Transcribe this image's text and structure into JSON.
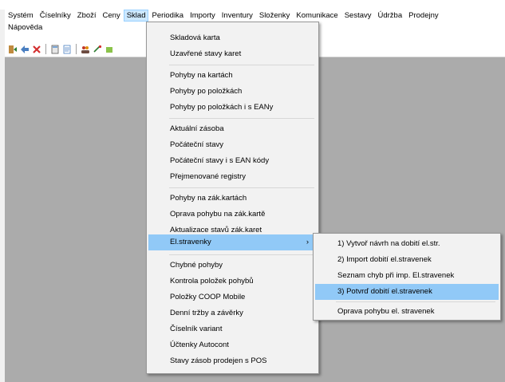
{
  "menubar": {
    "row1": [
      "Systém",
      "Číselníky",
      "Zboží",
      "Ceny",
      "Sklad",
      "Periodika",
      "Importy",
      "Inventury",
      "Složenky",
      "Komunikace",
      "Sestavy",
      "Údržba",
      "Prodejny"
    ],
    "row2": [
      "Nápověda"
    ],
    "active": "Sklad"
  },
  "toolbar": {
    "icons": [
      "door-exit-icon",
      "back-arrow-icon",
      "close-x-icon",
      "calculator-icon",
      "document-icon",
      "users-icon",
      "refresh-icon",
      "package-icon"
    ]
  },
  "sklad_menu": {
    "items": [
      {
        "label": "Skladová karta"
      },
      {
        "label": "Uzavřené stavy karet"
      },
      {
        "label": "Pohyby na kartách"
      },
      {
        "label": "Pohyby po položkách"
      },
      {
        "label": "Pohyby po položkách i s EANy"
      },
      {
        "label": "Aktuální zásoba"
      },
      {
        "label": "Počáteční stavy"
      },
      {
        "label": "Počáteční stavy i s EAN kódy"
      },
      {
        "label": "Přejmenované registry"
      },
      {
        "label": "Pohyby na zák.kartách"
      },
      {
        "label": "Oprava pohybu na zák.kartě"
      },
      {
        "label": "Aktualizace stavů zák.karet"
      },
      {
        "label": "El.stravenky",
        "submenu_arrow": "›"
      },
      {
        "label": "Chybné pohyby"
      },
      {
        "label": "Kontrola položek pohybů"
      },
      {
        "label": "Položky COOP Mobile"
      },
      {
        "label": "Denní tržby a závěrky"
      },
      {
        "label": "Číselník variant"
      },
      {
        "label": "Účtenky Autocont"
      },
      {
        "label": "Stavy zásob prodejen s POS"
      }
    ]
  },
  "elstravenky_menu": {
    "items": [
      {
        "label": "1) Vytvoř návrh na dobití el.str."
      },
      {
        "label": "2) Import dobití el.stravenek"
      },
      {
        "label": "Seznam chyb při imp. El.stravenek"
      },
      {
        "label": "3) Potvrď dobití el.stravenek"
      },
      {
        "label": "Oprava pohybu el. stravenek"
      }
    ]
  }
}
